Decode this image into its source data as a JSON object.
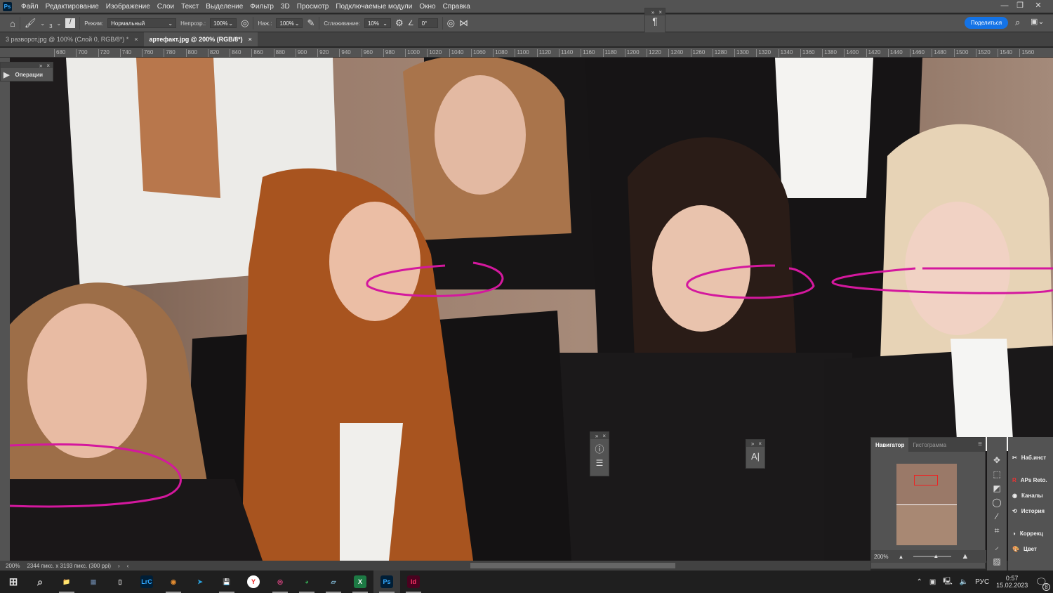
{
  "app": {
    "logo": "Ps"
  },
  "menu": [
    "Файл",
    "Редактирование",
    "Изображение",
    "Слои",
    "Текст",
    "Выделение",
    "Фильтр",
    "3D",
    "Просмотр",
    "Подключаемые модули",
    "Окно",
    "Справка"
  ],
  "window_controls": {
    "minimize": "—",
    "restore": "❐",
    "close": "✕"
  },
  "options": {
    "brush_size": "3",
    "mode_label": "Режим:",
    "mode_value": "Нормальный",
    "opacity_label": "Непрозр.:",
    "opacity_value": "100%",
    "flow_label": "Наж.:",
    "flow_value": "100%",
    "smoothing_label": "Сглаживание:",
    "smoothing_value": "10%",
    "angle_value": "0°",
    "share_label": "Поделиться"
  },
  "tabs": [
    {
      "label": "3 разворот.jpg @ 100% (Слой 0, RGB/8*) *",
      "close": "×"
    },
    {
      "label": "артефакт.jpg @ 200% (RGB/8*)",
      "close": "×"
    }
  ],
  "ruler_ticks": [
    "680",
    "700",
    "720",
    "740",
    "760",
    "780",
    "800",
    "820",
    "840",
    "860",
    "880",
    "900",
    "920",
    "940",
    "960",
    "980",
    "1000",
    "1020",
    "1040",
    "1060",
    "1080",
    "1100",
    "1120",
    "1140",
    "1160",
    "1180",
    "1200",
    "1220",
    "1240",
    "1260",
    "1280",
    "1300",
    "1320",
    "1340",
    "1360",
    "1380",
    "1400",
    "1420",
    "1440",
    "1460",
    "1480",
    "1500",
    "1520",
    "1540",
    "1560"
  ],
  "operations_panel": {
    "label": "Операции"
  },
  "status": {
    "zoom": "200%",
    "doc_info": "2344 пикс. x 3193 пикс. (300 ppi)"
  },
  "navigator": {
    "tabs": [
      "Навигатор",
      "Гистограмма"
    ],
    "zoom": "200%"
  },
  "panels": [
    "Наб.инст",
    "APs Reto.",
    "Каналы",
    "История",
    "Коррекц",
    "Цвет"
  ],
  "taskbar": {
    "apps": [
      {
        "name": "file-explorer",
        "label": "📁",
        "color": "#f3c03a"
      },
      {
        "name": "calculator",
        "label": "▦",
        "color": "#5a6f8a"
      },
      {
        "name": "notepad",
        "label": "▯",
        "color": "#eeeeee"
      },
      {
        "name": "lightroom-classic",
        "label": "LrC",
        "color": "#001e36"
      },
      {
        "name": "faststone",
        "label": "◉",
        "color": "#e08a30"
      },
      {
        "name": "telegram",
        "label": "➤",
        "color": "#2aa3e0"
      },
      {
        "name": "save-app",
        "label": "💾",
        "color": "#6470c8"
      },
      {
        "name": "yandex-browser",
        "label": "Y",
        "color": "#ffffff"
      },
      {
        "name": "creative-cloud",
        "label": "◎",
        "color": "#e34686"
      },
      {
        "name": "chrome",
        "label": "◕",
        "color": "#34a853"
      },
      {
        "name": "notes",
        "label": "▱",
        "color": "#8cc8e8"
      },
      {
        "name": "excel",
        "label": "X",
        "color": "#1d7a44"
      },
      {
        "name": "photoshop",
        "label": "Ps",
        "color": "#001e36"
      },
      {
        "name": "indesign",
        "label": "Id",
        "color": "#49021f"
      }
    ],
    "lang": "РУС",
    "time": "0:57",
    "date": "15.02.2023",
    "notifications": "8"
  },
  "colors": {
    "accent": "#1473e6",
    "stroke": "#d4189e"
  }
}
